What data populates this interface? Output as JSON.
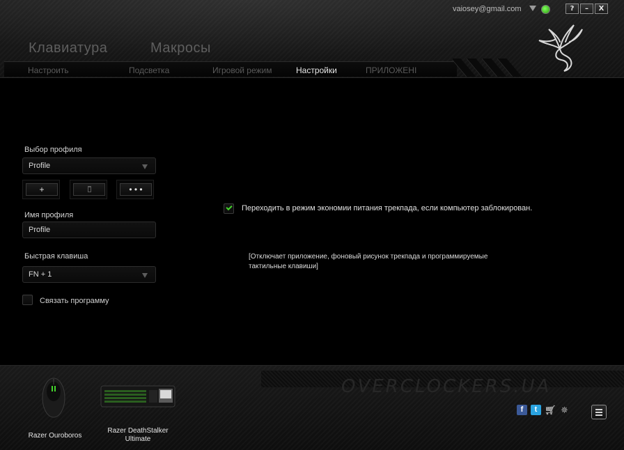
{
  "header": {
    "account_email": "vaiosey@gmail.com",
    "window_buttons": {
      "help": "?",
      "minimize": "–",
      "close": "X"
    },
    "main_tabs": [
      {
        "label": "Клавиатура"
      },
      {
        "label": "Макросы"
      }
    ],
    "sub_tabs": [
      {
        "label": "Настроить"
      },
      {
        "label": "Подсветка"
      },
      {
        "label": "Игровой режим"
      },
      {
        "label": "Настройки",
        "active": true
      },
      {
        "label": "ПРИЛОЖЕНI"
      }
    ]
  },
  "left_panel": {
    "profile_select_label": "Выбор профиля",
    "profile_select_value": "Profile",
    "buttons": {
      "add": "+",
      "more": "• • •"
    },
    "profile_name_label": "Имя профиля",
    "profile_name_value": "Profile",
    "hotkey_label": "Быстрая клавиша",
    "hotkey_value": "FN + 1",
    "link_program_label": "Связать программу",
    "link_program_checked": false
  },
  "main": {
    "power_save_label": "Переходить в режим экономии питания трекпада, если компьютер заблокирован.",
    "power_save_checked": true,
    "note": "[Отключает приложение, фоновый рисунок трекпада и программируемые тактильные клавиши]"
  },
  "footer": {
    "devices": [
      {
        "name": "Razer Ouroboros"
      },
      {
        "name": "Razer DeathStalker Ultimate"
      }
    ],
    "social_icons": [
      "facebook-icon",
      "twitter-icon",
      "cart-icon",
      "razer-icon"
    ]
  },
  "colors": {
    "accent_green": "#44d62c",
    "background": "#000000",
    "facebook": "#3b5998",
    "twitter": "#2aa3e0"
  }
}
